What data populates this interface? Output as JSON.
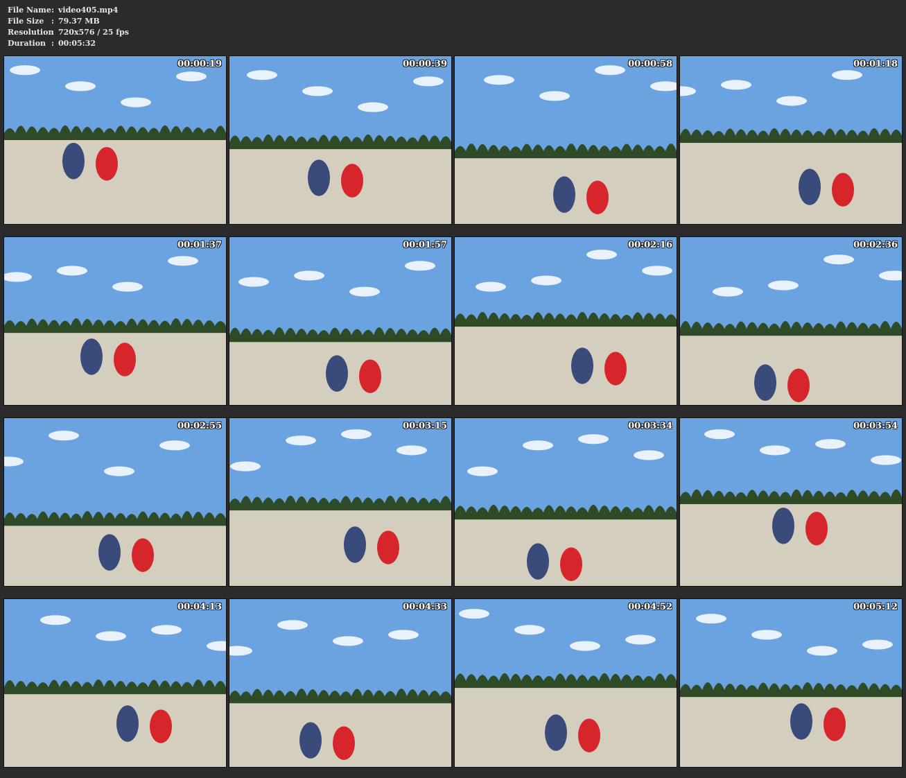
{
  "info": {
    "file_name_label": "File Name",
    "file_name": "video405.mp4",
    "file_size_label": "File Size",
    "file_size": "79.37 MB",
    "resolution_label": "Resolution",
    "resolution": "720x576 / 25 fps",
    "duration_label": "Duration",
    "duration": "00:05:32",
    "separator": ":"
  },
  "colors": {
    "background": "#2b2b2b",
    "sky": "#6aa3df",
    "sand": "#d4cebf",
    "trees": "#2f4a26",
    "red_suit": "#d6262c",
    "blue_suit": "#3a4a7a"
  },
  "thumbnails": [
    {
      "time": "00:00:19"
    },
    {
      "time": "00:00:39"
    },
    {
      "time": "00:00:58"
    },
    {
      "time": "00:01:18"
    },
    {
      "time": "00:01:37"
    },
    {
      "time": "00:01:57"
    },
    {
      "time": "00:02:16"
    },
    {
      "time": "00:02:36"
    },
    {
      "time": "00:02:55"
    },
    {
      "time": "00:03:15"
    },
    {
      "time": "00:03:34"
    },
    {
      "time": "00:03:54"
    },
    {
      "time": "00:04:13"
    },
    {
      "time": "00:04:33"
    },
    {
      "time": "00:04:52"
    },
    {
      "time": "00:05:12"
    }
  ]
}
